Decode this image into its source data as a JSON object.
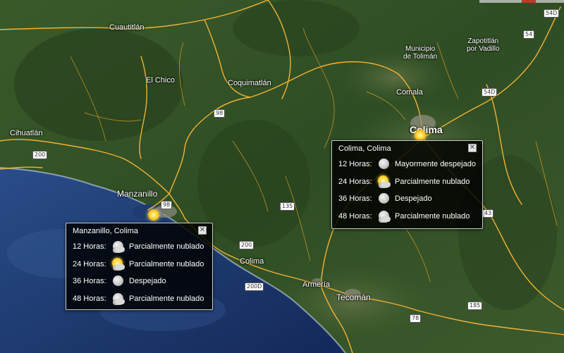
{
  "map": {
    "places": [
      {
        "id": "cuautitlan",
        "text": "Cuautitlán"
      },
      {
        "id": "el-chico",
        "text": "El Chico"
      },
      {
        "id": "coquimatlan",
        "text": "Coquimatlán"
      },
      {
        "id": "cihuatlan",
        "text": "Cihuatlán"
      },
      {
        "id": "manzanillo",
        "text": "Manzanillo"
      },
      {
        "id": "municipio-toliman",
        "text": "Municipio\nde Tolimán"
      },
      {
        "id": "zapotitlan",
        "text": "Zapotitlán\npor Vadillo"
      },
      {
        "id": "comala",
        "text": "Comala"
      },
      {
        "id": "colima-city",
        "text": "Colima"
      },
      {
        "id": "colima-town",
        "text": "Colima"
      },
      {
        "id": "armeria",
        "text": "Armería"
      },
      {
        "id": "tecoman",
        "text": "Tecomán"
      }
    ],
    "shields": [
      "200",
      "98",
      "98",
      "200",
      "200D",
      "135",
      "78",
      "185",
      "54",
      "54D",
      "54D",
      "43"
    ]
  },
  "popups": {
    "manzanillo": {
      "title": "Manzanillo, Colima",
      "close_icon": "close-x",
      "forecast": [
        {
          "period": "12 Horas:",
          "icon": "moon-cloud-icon",
          "condition": "Parcialmente nublado"
        },
        {
          "period": "24 Horas:",
          "icon": "sun-cloud-icon",
          "condition": "Parcialmente nublado"
        },
        {
          "period": "36 Horas:",
          "icon": "moon-icon",
          "condition": "Despejado"
        },
        {
          "period": "48 Horas:",
          "icon": "moon-cloud-icon",
          "condition": "Parcialmente nublado"
        }
      ]
    },
    "colima": {
      "title": "Colima, Colima",
      "close_icon": "close-x",
      "forecast": [
        {
          "period": "12 Horas:",
          "icon": "moon-icon",
          "condition": "Mayormente despejado"
        },
        {
          "period": "24 Horas:",
          "icon": "sun-cloud-icon",
          "condition": "Parcialmente nublado"
        },
        {
          "period": "36 Horas:",
          "icon": "moon-icon",
          "condition": "Despejado"
        },
        {
          "period": "48 Horas:",
          "icon": "moon-cloud-icon",
          "condition": "Parcialmente nublado"
        }
      ]
    }
  },
  "colors": {
    "road_primary": "#f2b233",
    "road_secondary": "#e9a526",
    "terrain": "#37552a",
    "ocean": "#1f3d72"
  }
}
